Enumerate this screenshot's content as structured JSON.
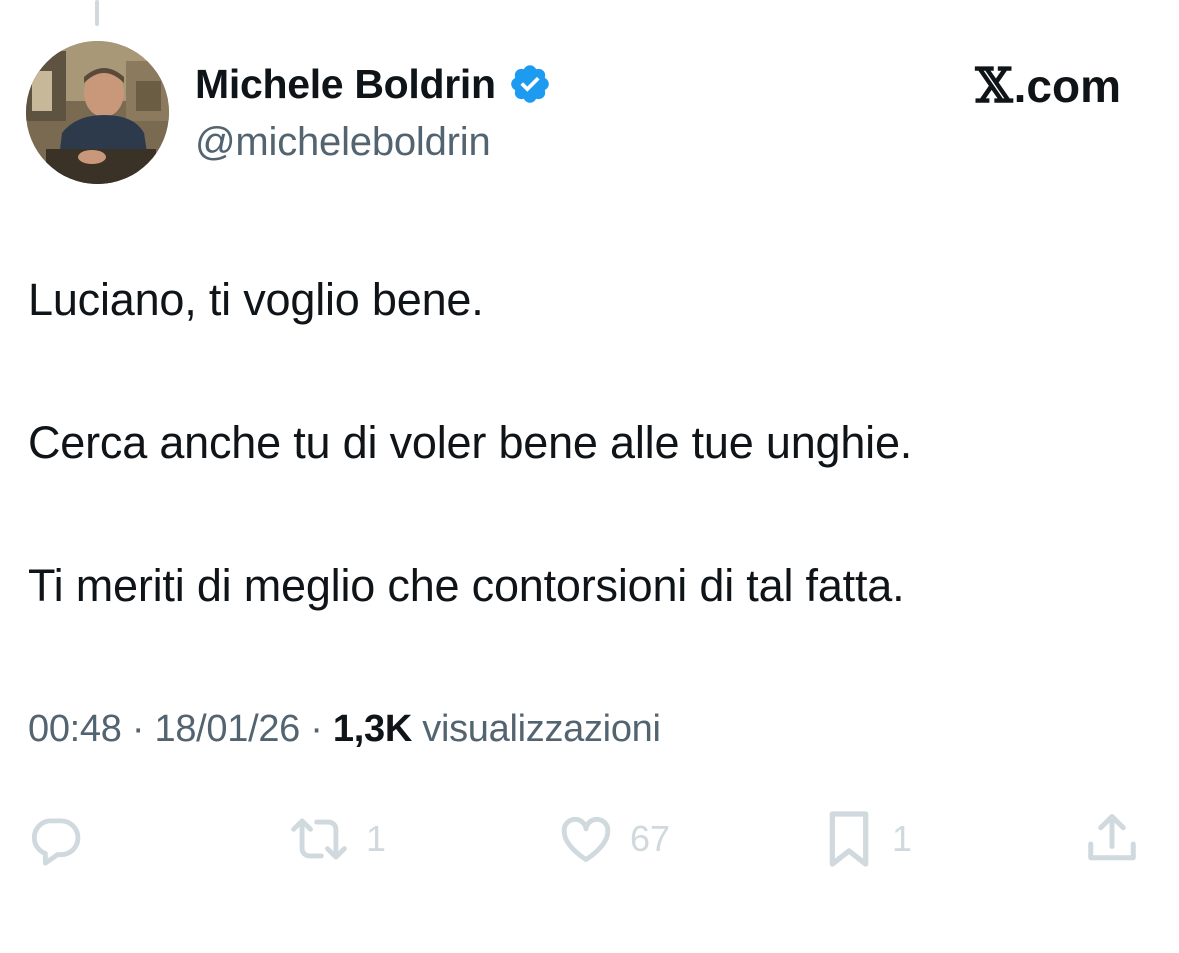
{
  "tweet": {
    "author": {
      "display_name": "Michele Boldrin",
      "handle": "@micheleboldrin",
      "verified": true,
      "avatar_icon": "profile-photo"
    },
    "brand_name": ".com",
    "brand_icon": "x-logo",
    "text_paragraphs": [
      "Luciano, ti voglio bene.",
      "Cerca anche tu di voler bene alle tue unghie.",
      "Ti meriti di meglio che contorsioni di tal fatta."
    ],
    "meta": {
      "time": "00:48",
      "separator": "·",
      "date": "18/01/26",
      "views_count": "1,3K",
      "views_label": "visualizzazioni"
    },
    "actions": {
      "reply": {
        "icon": "reply-icon",
        "count": ""
      },
      "repost": {
        "icon": "repost-icon",
        "count": "1"
      },
      "like": {
        "icon": "like-icon",
        "count": "67"
      },
      "bookmark": {
        "icon": "bookmark-icon",
        "count": "1"
      },
      "share": {
        "icon": "share-icon",
        "count": ""
      }
    }
  },
  "colors": {
    "text_primary": "#0f1419",
    "text_secondary": "#536471",
    "verified_badge": "#1d9bf0",
    "action_icons": "#cfd9de",
    "background": "#ffffff"
  }
}
